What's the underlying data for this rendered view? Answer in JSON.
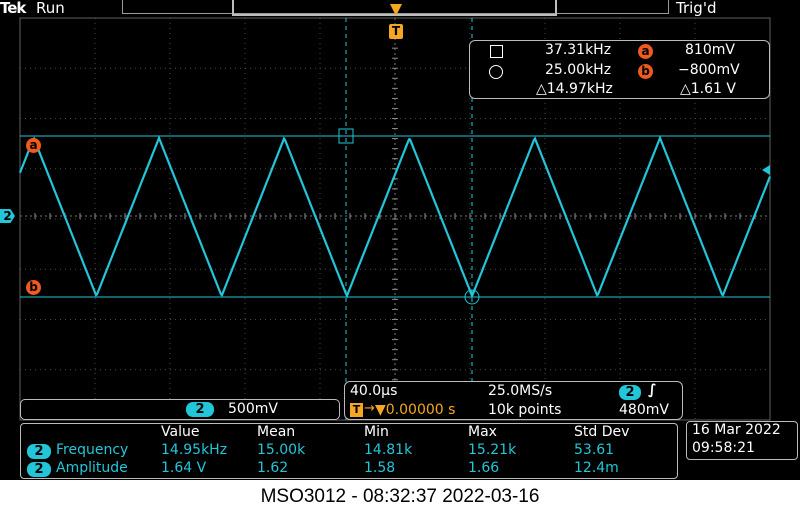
{
  "header": {
    "brand": "Tek",
    "run_state": "Run",
    "trigger_state": "Trig'd"
  },
  "markers": {
    "trigger_icon": "T",
    "cursor_a": "a",
    "cursor_b": "b",
    "channel": "2"
  },
  "cursor_readout": {
    "freq_1": "37.31kHz",
    "freq_2": "25.00kHz",
    "delta_freq": "△14.97kHz",
    "level_a": "810mV",
    "level_b": "−800mV",
    "delta_level": "△1.61 V"
  },
  "channel_scale": {
    "channel": "2",
    "volts_per_div": "500mV"
  },
  "horizontal": {
    "time_per_div": "40.0µs",
    "sample_rate": "25.0MS/s",
    "trigger_position": "▼0.00000 s",
    "record_length": "10k points",
    "trigger_channel": "2",
    "trigger_level": "480mV"
  },
  "measurements": {
    "headers": [
      "Value",
      "Mean",
      "Min",
      "Max",
      "Std Dev"
    ],
    "rows": [
      {
        "channel": "2",
        "name": "Frequency",
        "values": [
          "14.95kHz",
          "15.00k",
          "14.81k",
          "15.21k",
          "53.61"
        ]
      },
      {
        "channel": "2",
        "name": "Amplitude",
        "values": [
          "1.64 V",
          "1.62",
          "1.58",
          "1.66",
          "12.4m"
        ]
      }
    ]
  },
  "datetime": {
    "date": "16 Mar 2022",
    "time": "09:58:21"
  },
  "caption": "MSO3012 - 08:32:37   2022-03-16",
  "colors": {
    "trace": "#22c6d8",
    "cursor": "#22c6d8",
    "marker": "#f05a1c",
    "grid": "#4a4a4a"
  },
  "waveform": {
    "shape": "triangle",
    "period_divisions": 1.67,
    "high_level_mV": 810,
    "low_level_mV": -800
  }
}
